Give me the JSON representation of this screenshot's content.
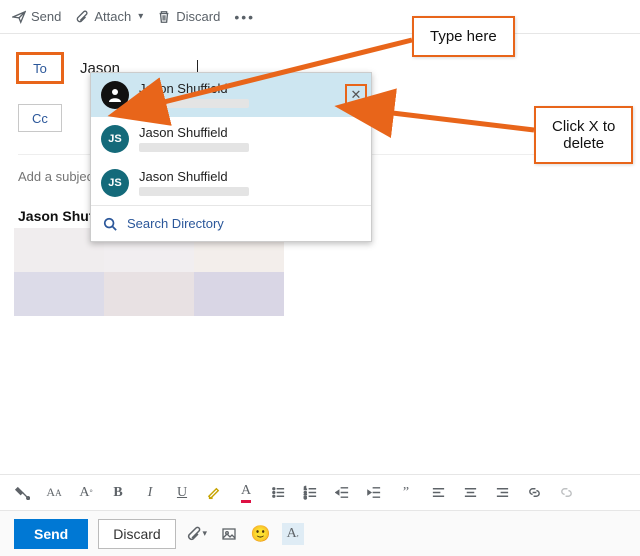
{
  "toolbar": {
    "send": "Send",
    "attach": "Attach",
    "discard": "Discard"
  },
  "fields": {
    "to_label": "To",
    "cc_label": "Cc",
    "to_value": "Jason",
    "subject_placeholder": "Add a subject"
  },
  "suggestions": {
    "items": [
      {
        "name": "Jason Shuffield",
        "initials": "",
        "avatar": "pic",
        "selected": true
      },
      {
        "name": "Jason Shuffield",
        "initials": "JS",
        "avatar": "initials",
        "selected": false
      },
      {
        "name": "Jason Shuffield",
        "initials": "JS",
        "avatar": "initials",
        "selected": false
      }
    ],
    "search_label": "Search Directory"
  },
  "signature": {
    "name": "Jason Shuffield"
  },
  "annotations": {
    "type_here": "Type here",
    "click_x": "Click X to\ndelete"
  },
  "bottom": {
    "send": "Send",
    "discard": "Discard"
  },
  "colors": {
    "accent": "#0078d4",
    "annotation": "#e8651a",
    "avatar": "#146a7a"
  }
}
